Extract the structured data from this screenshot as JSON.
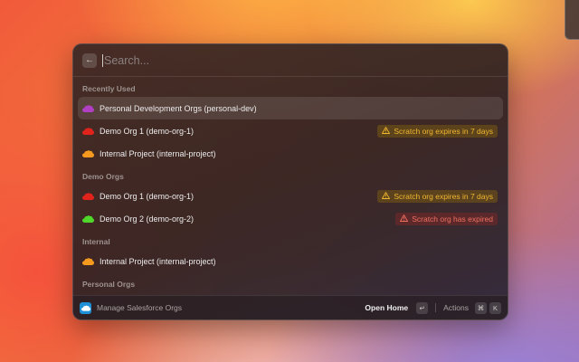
{
  "search": {
    "placeholder": "Search..."
  },
  "sections": {
    "recent": {
      "title": "Recently Used",
      "items": [
        {
          "label": "Personal Development Orgs (personal-dev)",
          "color": "#b03fc4"
        },
        {
          "label": "Demo Org 1 (demo-org-1)",
          "color": "#e0241c",
          "badge": {
            "kind": "warning",
            "text": "Scratch org expires in 7 days"
          }
        },
        {
          "label": "Internal Project (internal-project)",
          "color": "#f59a1f"
        }
      ]
    },
    "demo": {
      "title": "Demo Orgs",
      "items": [
        {
          "label": "Demo Org 1 (demo-org-1)",
          "color": "#e0241c",
          "badge": {
            "kind": "warning",
            "text": "Scratch org expires in 7 days"
          }
        },
        {
          "label": "Demo Org 2 (demo-org-2)",
          "color": "#4fd82b",
          "badge": {
            "kind": "error",
            "text": "Scratch org has expired"
          }
        }
      ]
    },
    "internal": {
      "title": "Internal",
      "items": [
        {
          "label": "Internal Project (internal-project)",
          "color": "#f59a1f"
        }
      ]
    },
    "personal": {
      "title": "Personal Orgs"
    }
  },
  "footer": {
    "title": "Manage Salesforce Orgs",
    "primary_action": "Open Home",
    "primary_key": "↵",
    "actions_label": "Actions",
    "actions_keys": [
      "⌘",
      "K"
    ]
  },
  "icons": {
    "back": "arrow-left-icon",
    "org": "salesforce-cloud-icon",
    "warning": "warning-triangle-icon",
    "app": "salesforce-app-icon"
  },
  "colors": {
    "warning_text": "#f1b72e",
    "error_text": "#f07060"
  }
}
